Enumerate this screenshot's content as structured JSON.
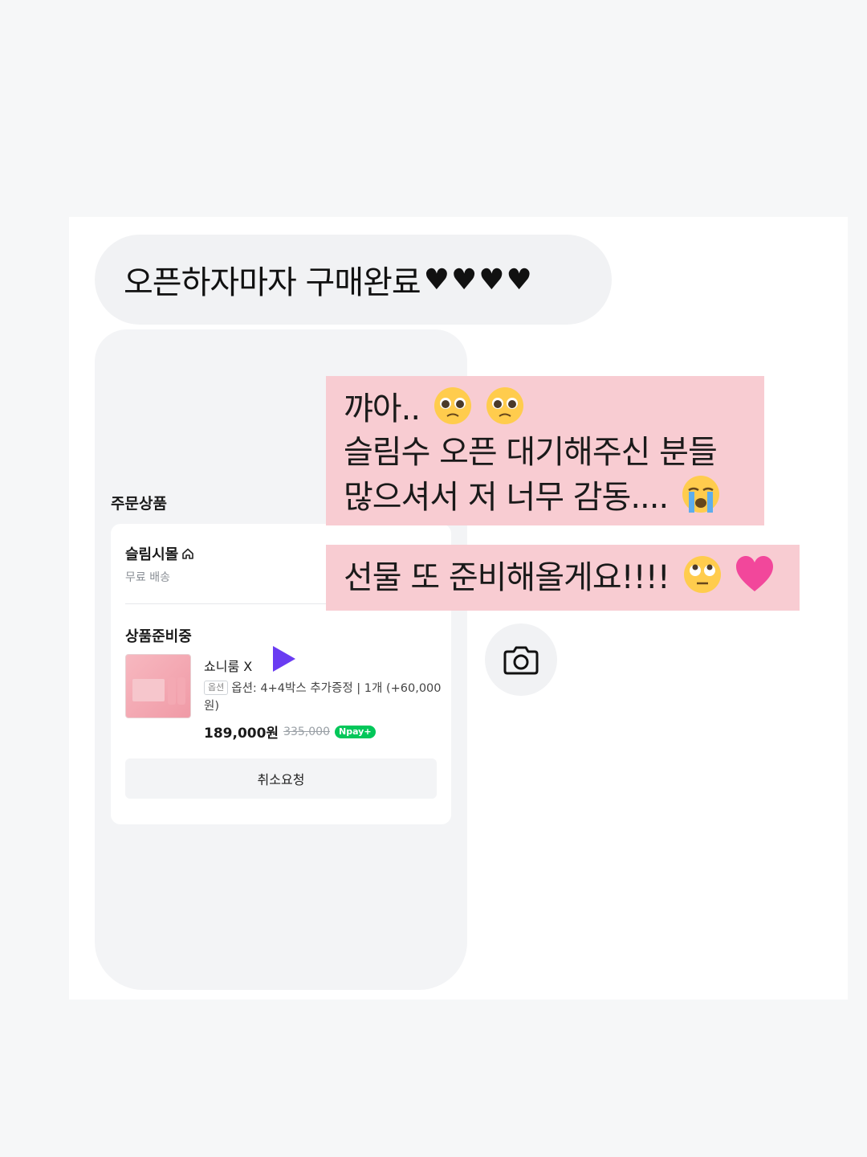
{
  "top_message": {
    "text": "오픈하자마자 구매완료",
    "hearts": "♥♥♥♥"
  },
  "order": {
    "section_title": "주문상품",
    "shop_name": "슬림시몰",
    "shipping": "무료 배송",
    "status": "상품준비중",
    "product_name": "쇼니룸 X",
    "option_badge": "옵션",
    "option_text": "옵션: 4+4박스 추가증정 | 1개 (+60,000원)",
    "price": "189,000원",
    "original_price": "335,000",
    "npay_label": "Npay+",
    "cancel_label": "취소요청"
  },
  "pink_messages": [
    {
      "line1": "꺄아..",
      "line2": "슬림수 오픈 대기해주신 분들",
      "line3": "많으셔서 저 너무 감동...."
    },
    {
      "line1": "선물 또 준비해올게요!!!!"
    }
  ],
  "icons": {
    "home": "home-icon",
    "play": "play-icon",
    "camera": "camera-icon",
    "emoji_pleading": "pleading-face-emoji",
    "emoji_crying": "loudly-crying-face-emoji",
    "emoji_rolling_eyes": "face-with-rolling-eyes-emoji",
    "emoji_pink_heart": "pink-heart-emoji"
  },
  "colors": {
    "pink_highlight": "#f8ccd2",
    "npay_green": "#03c75a",
    "play_purple": "#6a3cf2"
  }
}
